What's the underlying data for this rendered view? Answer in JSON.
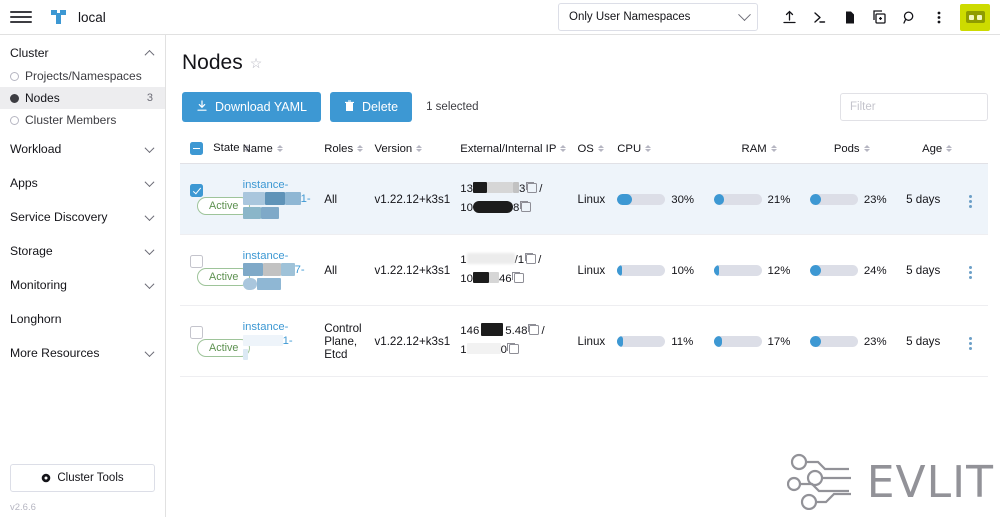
{
  "topbar": {
    "menu_icon": "hamburger-icon",
    "cluster_logo_icon": "kubernetes-logo-icon",
    "cluster_name": "local",
    "namespace_filter": {
      "value": "Only User Namespaces",
      "chevron_icon": "chevron-down-icon"
    },
    "icons": [
      {
        "name": "import-yaml-icon",
        "title": "Import YAML"
      },
      {
        "name": "kubectl-shell-icon",
        "title": "Kubectl Shell"
      },
      {
        "name": "docs-icon",
        "title": "Docs"
      },
      {
        "name": "cluster-copy-icon",
        "title": "Copy KubeConfig"
      },
      {
        "name": "search-icon",
        "title": "Search"
      },
      {
        "name": "overflow-menu-icon",
        "title": "More"
      }
    ],
    "avatar_icon": "user-avatar-icon"
  },
  "sidebar": {
    "groups": [
      {
        "label": "Cluster",
        "expanded": true,
        "caret": "chevron-up-icon",
        "items": [
          {
            "label": "Projects/Namespaces",
            "count": "",
            "active": false
          },
          {
            "label": "Nodes",
            "count": "3",
            "active": true
          },
          {
            "label": "Cluster Members",
            "count": "",
            "active": false
          }
        ]
      },
      {
        "label": "Workload",
        "expanded": false,
        "caret": "chevron-down-icon",
        "items": []
      },
      {
        "label": "Apps",
        "expanded": false,
        "caret": "chevron-down-icon",
        "items": []
      },
      {
        "label": "Service Discovery",
        "expanded": false,
        "caret": "chevron-down-icon",
        "items": []
      },
      {
        "label": "Storage",
        "expanded": false,
        "caret": "chevron-down-icon",
        "items": []
      },
      {
        "label": "Monitoring",
        "expanded": false,
        "caret": "chevron-down-icon",
        "items": []
      },
      {
        "label": "Longhorn",
        "expanded": false,
        "caret": "",
        "items": []
      },
      {
        "label": "More Resources",
        "expanded": false,
        "caret": "chevron-down-icon",
        "items": []
      }
    ],
    "cluster_tools_label": "Cluster Tools",
    "cluster_tools_icon": "gear-icon",
    "version": "v2.6.6"
  },
  "main": {
    "page_title": "Nodes",
    "favorite_icon": "star-outline-icon",
    "buttons": {
      "download_yaml": "Download YAML",
      "download_yaml_icon": "download-icon",
      "delete": "Delete",
      "delete_icon": "trash-icon"
    },
    "selection_note": "1 selected",
    "filter_placeholder": "Filter",
    "columns": [
      {
        "label": "State",
        "sortable": true
      },
      {
        "label": "Name",
        "sortable": true
      },
      {
        "label": "Roles",
        "sortable": true
      },
      {
        "label": "Version",
        "sortable": true
      },
      {
        "label": "External/Internal IP",
        "sortable": true
      },
      {
        "label": "OS",
        "sortable": true
      },
      {
        "label": "CPU",
        "sortable": true
      },
      {
        "label": "RAM",
        "sortable": true
      },
      {
        "label": "Pods",
        "sortable": true
      },
      {
        "label": "Age",
        "sortable": true
      }
    ],
    "rows": [
      {
        "selected": true,
        "state": "Active",
        "name_prefix": "instance-",
        "name_suffix": "1-",
        "name_redacted": true,
        "roles": "All",
        "version": "v1.22.12+k3s1",
        "external_ip_prefix": "13",
        "external_ip_suffix": "3",
        "internal_ip_prefix": "10",
        "internal_ip_suffix": "8",
        "os": "Linux",
        "cpu": "30%",
        "cpu_value": 30,
        "ram": "21%",
        "ram_value": 21,
        "pods": "23%",
        "pods_value": 23,
        "age": "5 days",
        "menu_icon": "row-actions-icon"
      },
      {
        "selected": false,
        "state": "Active",
        "name_prefix": "instance-",
        "name_suffix": "7-",
        "name_redacted": true,
        "roles": "All",
        "version": "v1.22.12+k3s1",
        "external_ip_prefix": "1",
        "external_ip_suffix": "/1",
        "internal_ip_prefix": "10",
        "internal_ip_suffix": "46",
        "os": "Linux",
        "cpu": "10%",
        "cpu_value": 10,
        "ram": "12%",
        "ram_value": 12,
        "pods": "24%",
        "pods_value": 24,
        "age": "5 days",
        "menu_icon": "row-actions-icon"
      },
      {
        "selected": false,
        "state": "Active",
        "name_prefix": "instance-",
        "name_suffix": "1-",
        "name_redacted": true,
        "roles": "Control Plane, Etcd",
        "version": "v1.22.12+k3s1",
        "external_ip_prefix": "146",
        "external_ip_suffix": "5.48",
        "internal_ip_prefix": "1",
        "internal_ip_suffix": "0",
        "os": "Linux",
        "cpu": "11%",
        "cpu_value": 11,
        "ram": "17%",
        "ram_value": 17,
        "pods": "23%",
        "pods_value": 23,
        "age": "5 days",
        "menu_icon": "row-actions-icon"
      }
    ]
  },
  "watermark": {
    "text": "EVLIT",
    "icon": "circuit-nodes-icon"
  },
  "colors": {
    "accent": "#3d98d3",
    "avatar_bg": "#cddb00",
    "active_pill_border": "#9ec49a",
    "active_pill_text": "#5d9150",
    "meter_track": "#dcdee7",
    "row_selected_bg": "#eef4fa"
  }
}
